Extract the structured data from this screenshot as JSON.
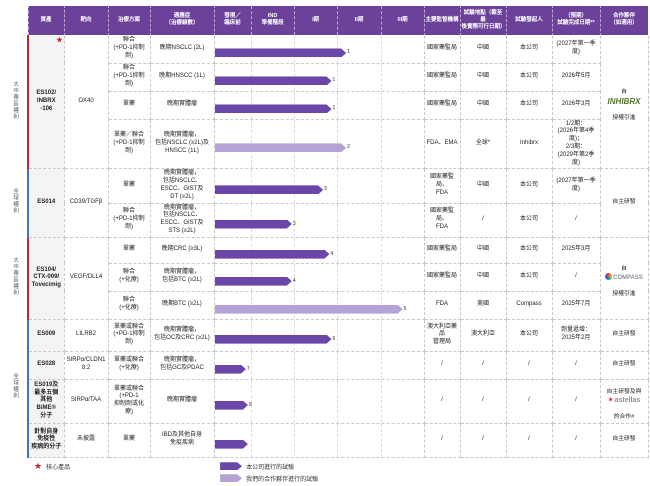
{
  "palette": {
    "header_bg": "#6b4199",
    "bar_dark": "#6a46a8",
    "bar_light": "#b5a3d8",
    "core_star_red": "#cc2027",
    "rail_red": "#c0272d",
    "rail_blue": "#4472c4",
    "inhibrx_green": "#55742c",
    "astellas_red": "#d0021b",
    "asset_col_bg": "#f4f3f6"
  },
  "icons": {
    "core_star": "★",
    "astellas_star": "✶"
  },
  "header": {
    "asset": "資產",
    "target": "靶向",
    "regimen": "治療方案",
    "indication": "適應症\n（治療線數）",
    "phases": [
      "發現／\n臨床前",
      "IND\n準備階段",
      "I期",
      "II期",
      "III期"
    ],
    "regulator": "主要監管機構",
    "location": "試驗地點（截至最\n後實際可行日期）",
    "sponsor": "試驗發起人",
    "date": "（預期）\n試驗完成日期**",
    "partner": "合作夥伴\n（如適用）"
  },
  "rails": [
    {
      "text": "大中華區權利",
      "color": "red"
    },
    {
      "text": "全球權利",
      "color": "blue"
    },
    {
      "text": "大中華區權利",
      "color": "red"
    },
    {
      "text": "全球權利",
      "color": "blue"
    }
  ],
  "groups": [
    {
      "asset": "ES102/\nINBRX\n-106",
      "core": true,
      "target": "OX40",
      "partner": {
        "line1": "自",
        "logo_text": "INHIBRX",
        "line2": "授權引進"
      },
      "rows": [
        {
          "regimen": "聯合\n(+PD-1抑制劑)",
          "indication": "晚期NSCLC (2L)",
          "bar": {
            "end_pct": 63,
            "owner": "company",
            "sup": "1"
          },
          "regulator": "國家藥監局",
          "location": "中國",
          "sponsor": "本公司",
          "date": "(2027年第一季度)"
        },
        {
          "regimen": "聯合\n(+PD-1抑制劑)",
          "indication": "晚期HNSCC (1L)",
          "bar": {
            "end_pct": 56,
            "owner": "company",
            "sup": "1"
          },
          "regulator": "國家藥監局",
          "location": "中國",
          "sponsor": "本公司",
          "date": "2026年5月"
        },
        {
          "regimen": "單藥",
          "indication": "晚期實體瘤",
          "bar": {
            "end_pct": 56,
            "owner": "company",
            "sup": "1"
          },
          "regulator": "國家藥監局",
          "location": "中國",
          "sponsor": "本公司",
          "date": "2026年3月"
        },
        {
          "regimen": "單藥／聯合\n(+PD-1抑制劑)",
          "indication": "晚期實體瘤，\n包括NSCLC (≥2L)及\nHNSCC (1L)",
          "bar": {
            "end_pct": 63,
            "owner": "partner",
            "sup": "2"
          },
          "regulator": "FDA、EMA",
          "location": "全球*",
          "sponsor": "Inhibrx",
          "date": "1/2期：\n(2026年第4季度)；\n2/3期：\n(2029年第2季度)"
        }
      ]
    },
    {
      "asset": "ES014",
      "core": false,
      "target": "CD39/TGFβ",
      "partner": {
        "text": "自主研發"
      },
      "rows": [
        {
          "regimen": "單藥",
          "indication": "晚期實體瘤，\n包括NSCLC、\nESCC、GIST及\nDT (≥2L)",
          "bar": {
            "end_pct": 52,
            "owner": "company",
            "sup": "3"
          },
          "regulator": "國家藥監局、\nFDA",
          "location": "中國",
          "sponsor": "本公司",
          "date": "(2027年第一季度)"
        },
        {
          "regimen": "聯合\n(+PD-1抑制劑)",
          "indication": "晚期實體瘤，\n包括NSCLC、\nESCC、GIST及\nSTS (≥2L)",
          "bar": {
            "end_pct": 37,
            "owner": "company",
            "sup": "3"
          },
          "regulator": "國家藥監局、\nFDA",
          "location": "/",
          "sponsor": "本公司",
          "date": "/"
        }
      ]
    },
    {
      "asset": "ES104/\nCTX-009/\nTovecimig",
      "core": false,
      "target": "VEGF/DLL4",
      "partner": {
        "line1": "自",
        "logo_text": "COMPASS",
        "line2": "授權引進"
      },
      "rows": [
        {
          "regimen": "單藥",
          "indication": "晚期CRC (≥3L)",
          "bar": {
            "end_pct": 55,
            "owner": "company",
            "sup": "4"
          },
          "regulator": "國家藥監局",
          "location": "中國",
          "sponsor": "本公司",
          "date": "2025年3月"
        },
        {
          "regimen": "聯合\n(+化療)",
          "indication": "晚期實體瘤，\n包括BTC (≥2L)",
          "bar": {
            "end_pct": 37,
            "owner": "company",
            "sup": "4"
          },
          "regulator": "國家藥監局",
          "location": "中國",
          "sponsor": "本公司",
          "date": "/"
        },
        {
          "regimen": "聯合\n(+化療)",
          "indication": "晚期BTC (≥2L)",
          "bar": {
            "end_pct": 90,
            "owner": "partner",
            "sup": "5"
          },
          "regulator": "FDA",
          "location": "美國",
          "sponsor": "Compass",
          "date": "2025年7月"
        }
      ]
    },
    {
      "asset": "ES009",
      "core": false,
      "target": "LILRB2",
      "partner": {
        "text": "自主研發"
      },
      "rows": [
        {
          "regimen": "單藥或聯合\n(+PD-1抑制劑)",
          "indication": "晚期實體瘤，\n包括OC及CRC (≥2L)",
          "bar": {
            "end_pct": 56,
            "owner": "company",
            "sup": "6"
          },
          "regulator": "澳大利亞藥品\n管理局",
          "location": "澳大利亞",
          "sponsor": "本公司",
          "date": "劑量遞增：\n2025年2月"
        }
      ]
    },
    {
      "asset": "ES028",
      "core": false,
      "target": "SIRPα/CLDN18.2",
      "partner": {
        "text": "自主研發"
      },
      "rows": [
        {
          "regimen": "單藥或聯合\n(+化療)",
          "indication": "晚期實體瘤，\n包括GC及PDAC",
          "bar": {
            "end_pct": 15,
            "owner": "company",
            "sup": "7"
          },
          "regulator": "/",
          "location": "/",
          "sponsor": "/",
          "date": "/"
        }
      ]
    },
    {
      "asset": "ES019及\n最多五個\n其他BiME®\n分子",
      "core": false,
      "target": "SIRPα/TAA",
      "partner": {
        "line1": "自主研發及與",
        "logo_text": "astellas",
        "line2": "的合作#"
      },
      "rows": [
        {
          "regimen": "單藥或聯合\n(+PD-1\n抑制劑或化療)",
          "indication": "晚期實體瘤",
          "bar": {
            "end_pct": 16,
            "owner": "company",
            "sup": "8"
          },
          "regulator": "/",
          "location": "/",
          "sponsor": "/",
          "date": "/"
        }
      ]
    },
    {
      "asset": "針對自身\n免疫性\n疾病的分子",
      "core": false,
      "target": "未披露",
      "partner": {
        "text": "自主研發"
      },
      "rows": [
        {
          "regimen": "單藥",
          "indication": "IBD及其他自身\n免疫疾病",
          "bar": {
            "end_pct": 16,
            "owner": "company",
            "sup": ""
          },
          "regulator": "/",
          "location": "/",
          "sponsor": "/",
          "date": "/"
        }
      ]
    }
  ],
  "legend": {
    "core_product": "核心產品",
    "company_trial": "本公司進行的試驗",
    "partner_trial": "我們的合作夥伴進行的試驗"
  },
  "chart_data": {
    "type": "bar",
    "orientation": "horizontal",
    "phase_axis": [
      "發現／臨床前",
      "IND準備階段",
      "I期",
      "II期",
      "III期"
    ],
    "legend_position": "bottom",
    "grid": "dashed-vertical",
    "bars": [
      {
        "label": "ES102 聯合(+PD-1抑制劑) 晚期NSCLC (2L)",
        "owner": "本公司",
        "end_pct": 63,
        "stage_reached": "II期",
        "footnote": "1"
      },
      {
        "label": "ES102 聯合(+PD-1抑制劑) 晚期HNSCC (1L)",
        "owner": "本公司",
        "end_pct": 56,
        "stage_reached": "II期",
        "footnote": "1"
      },
      {
        "label": "ES102 單藥 晚期實體瘤",
        "owner": "本公司",
        "end_pct": 56,
        "stage_reached": "II期",
        "footnote": "1"
      },
      {
        "label": "ES102 單藥／聯合 晚期實體瘤 NSCLC(≥2L)及HNSCC(1L)",
        "owner": "合作夥伴",
        "end_pct": 63,
        "stage_reached": "II期",
        "footnote": "2"
      },
      {
        "label": "ES014 單藥 晚期實體瘤 (NSCLC、ESCC、GIST及DT ≥2L)",
        "owner": "本公司",
        "end_pct": 52,
        "stage_reached": "II期",
        "footnote": "3"
      },
      {
        "label": "ES014 聯合(+PD-1抑制劑) 晚期實體瘤 (≥2L)",
        "owner": "本公司",
        "end_pct": 37,
        "stage_reached": "I期",
        "footnote": "3"
      },
      {
        "label": "ES104 單藥 晚期CRC (≥3L)",
        "owner": "本公司",
        "end_pct": 55,
        "stage_reached": "II期",
        "footnote": "4"
      },
      {
        "label": "ES104 聯合(+化療) 晚期實體瘤 包括BTC (≥2L)",
        "owner": "本公司",
        "end_pct": 37,
        "stage_reached": "I期",
        "footnote": "4"
      },
      {
        "label": "ES104 聯合(+化療) 晚期BTC (≥2L)",
        "owner": "合作夥伴",
        "end_pct": 90,
        "stage_reached": "III期",
        "footnote": "5"
      },
      {
        "label": "ES009 單藥或聯合 晚期實體瘤 包括OC及CRC (≥2L)",
        "owner": "本公司",
        "end_pct": 56,
        "stage_reached": "II期",
        "footnote": "6"
      },
      {
        "label": "ES028 單藥或聯合 晚期實體瘤 包括GC及PDAC",
        "owner": "本公司",
        "end_pct": 15,
        "stage_reached": "IND準備階段",
        "footnote": "7"
      },
      {
        "label": "ES019及最多五個其他BiME®分子 晚期實體瘤",
        "owner": "本公司",
        "end_pct": 16,
        "stage_reached": "IND準備階段",
        "footnote": "8"
      },
      {
        "label": "針對自身免疫性疾病的分子 IBD及其他自身免疫疾病",
        "owner": "本公司",
        "end_pct": 16,
        "stage_reached": "IND準備階段",
        "footnote": ""
      }
    ]
  }
}
